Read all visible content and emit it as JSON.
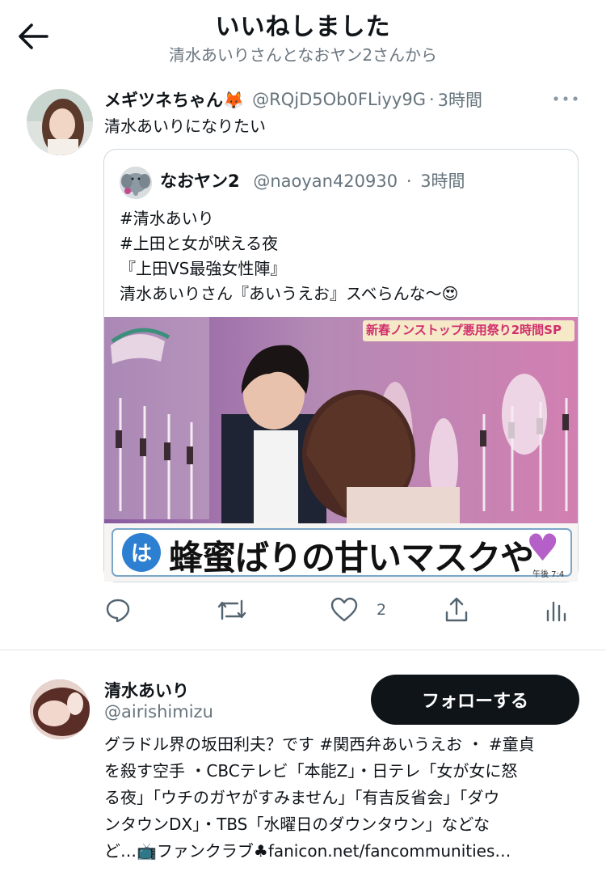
{
  "header": {
    "title": "いいねしました",
    "subtitle": "清水あいりさんとなおヤン2さんから",
    "back_icon": "arrow-left-icon"
  },
  "tweet": {
    "display_name": "メギツネちゃん🦊",
    "handle": "@RQjD5Ob0FLiyy9G",
    "separator": "·",
    "time": "3時間",
    "text": "清水あいりになりたい",
    "more_icon": "more-dots-icon",
    "quote": {
      "display_name": "なおヤン2",
      "handle": "@naoyan420930",
      "separator": "·",
      "time": "3時間",
      "lines": [
        "#清水あいり",
        "#上田と女が吠える夜",
        "『上田VS最強女性陣』",
        "清水あいりさん『あいうえお』スベらんな〜😍"
      ],
      "media": {
        "banner_top": "新春ノンストップ悪用祭り2時間SP",
        "caption_badge": "は",
        "caption": "蜂蜜ばりの甘いマスクや",
        "caption_heart": "♥",
        "corner_time": "午後 7:4"
      }
    },
    "actions": {
      "reply_icon": "reply-icon",
      "retweet_icon": "retweet-icon",
      "like_icon": "heart-icon",
      "like_count": "2",
      "share_icon": "share-icon",
      "analytics_icon": "analytics-icon"
    }
  },
  "user_card": {
    "display_name": "清水あいり",
    "handle": "@airishimizu",
    "follow_label": "フォローする",
    "bio_lines": [
      "グラドル界の坂田利夫？です #関西弁あいうえお ・ #童貞",
      "を殺す空手 ・CBCテレビ「本能Z」・日テレ「女が女に怒",
      "る夜」「ウチのガヤがすみません」「有吉反省会」「ダウ",
      "ンタウンDX」・TBS「水曜日のダウンタウン」などな",
      "ど…📺ファンクラブ♣fanicon.net/fancommunities…"
    ]
  },
  "colors": {
    "text": "#0f1419",
    "muted": "#66747d",
    "border": "#cfd9de",
    "follow_bg": "#0f1419"
  }
}
